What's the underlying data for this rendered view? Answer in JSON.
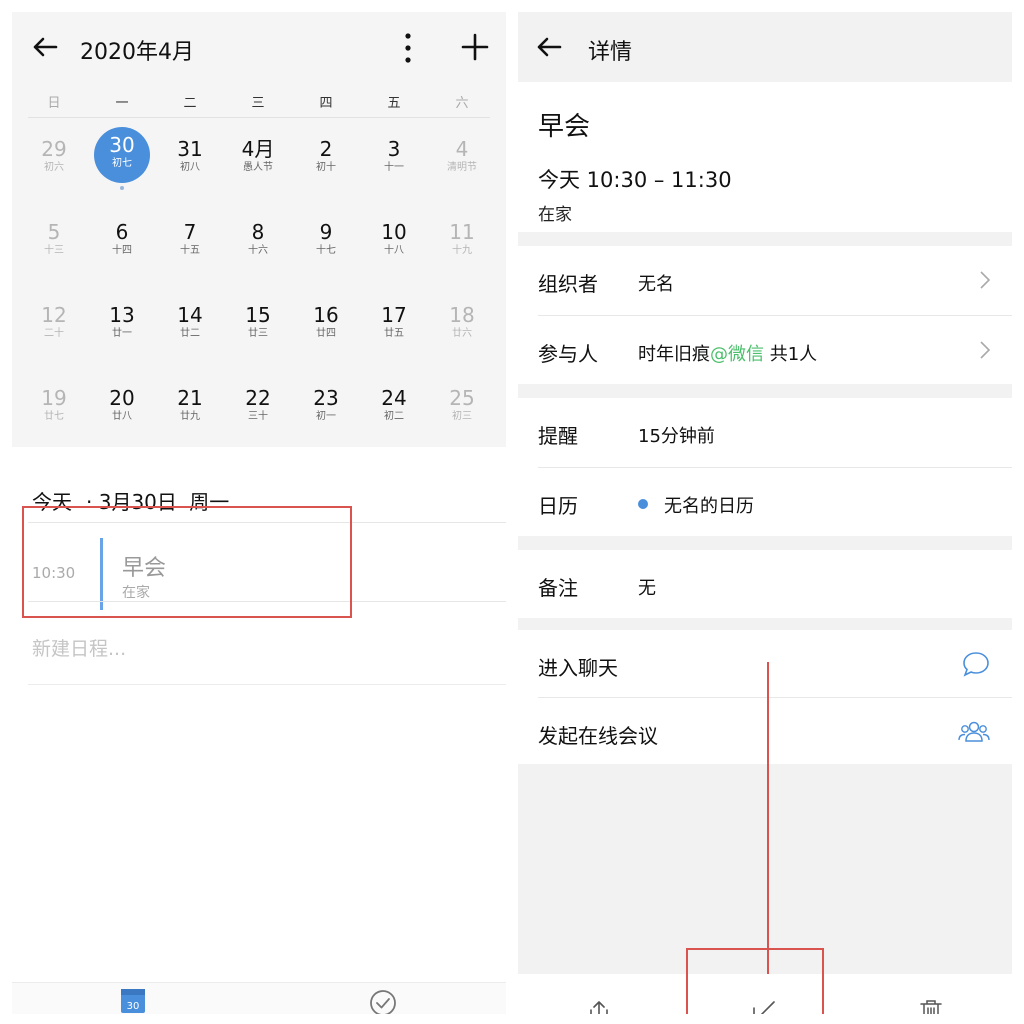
{
  "left": {
    "header": {
      "month_title": "2020年4月"
    },
    "weekdays": [
      "日",
      "一",
      "二",
      "三",
      "四",
      "五",
      "六"
    ],
    "weeks": [
      [
        {
          "num": "29",
          "lunar": "初六",
          "dim": true
        },
        {
          "num": "30",
          "lunar": "初七",
          "today": true
        },
        {
          "num": "31",
          "lunar": "初八"
        },
        {
          "num": "4月",
          "lunar": "愚人节"
        },
        {
          "num": "2",
          "lunar": "初十"
        },
        {
          "num": "3",
          "lunar": "十一"
        },
        {
          "num": "4",
          "lunar": "清明节",
          "dim": true
        }
      ],
      [
        {
          "num": "5",
          "lunar": "十三",
          "dim": true
        },
        {
          "num": "6",
          "lunar": "十四"
        },
        {
          "num": "7",
          "lunar": "十五"
        },
        {
          "num": "8",
          "lunar": "十六"
        },
        {
          "num": "9",
          "lunar": "十七"
        },
        {
          "num": "10",
          "lunar": "十八"
        },
        {
          "num": "11",
          "lunar": "十九",
          "dim": true
        }
      ],
      [
        {
          "num": "12",
          "lunar": "二十",
          "dim": true
        },
        {
          "num": "13",
          "lunar": "廿一"
        },
        {
          "num": "14",
          "lunar": "廿二"
        },
        {
          "num": "15",
          "lunar": "廿三"
        },
        {
          "num": "16",
          "lunar": "廿四"
        },
        {
          "num": "17",
          "lunar": "廿五"
        },
        {
          "num": "18",
          "lunar": "廿六",
          "dim": true
        }
      ],
      [
        {
          "num": "19",
          "lunar": "廿七",
          "dim": true
        },
        {
          "num": "20",
          "lunar": "廿八"
        },
        {
          "num": "21",
          "lunar": "廿九"
        },
        {
          "num": "22",
          "lunar": "三十"
        },
        {
          "num": "23",
          "lunar": "初一"
        },
        {
          "num": "24",
          "lunar": "初二"
        },
        {
          "num": "25",
          "lunar": "初三",
          "dim": true
        }
      ]
    ],
    "today_label": "今天",
    "today_date": "· 3月30日",
    "today_weekday": "周一",
    "event": {
      "time": "10:30",
      "title": "早会",
      "location": "在家"
    },
    "new_event_placeholder": "新建日程...",
    "tabbar": {
      "calendar_day": "30"
    }
  },
  "right": {
    "header": {
      "title": "详情"
    },
    "event_title": "早会",
    "event_time": "今天 10:30 – 11:30",
    "event_location": "在家",
    "organizer": {
      "label": "组织者",
      "value": "无名"
    },
    "participants": {
      "label": "参与人",
      "name": "时年旧痕",
      "source": "@微信",
      "count": "共1人"
    },
    "reminder": {
      "label": "提醒",
      "value": "15分钟前"
    },
    "calendar": {
      "label": "日历",
      "value": "无名的日历"
    },
    "note": {
      "label": "备注",
      "value": "无"
    },
    "chat": {
      "label": "进入聊天"
    },
    "meeting": {
      "label": "发起在线会议"
    }
  },
  "colors": {
    "accent_blue": "#4a8fdc",
    "annotation_red": "#d9534f",
    "wechat_green": "#4bbf6b"
  },
  "icons": {
    "back": "arrow-left-icon",
    "more": "more-vertical-icon",
    "add": "plus-icon",
    "chevron": "chevron-right-icon",
    "chat": "chat-bubble-icon",
    "meeting": "group-users-icon",
    "share": "share-icon",
    "edit": "edit-icon",
    "delete": "trash-icon",
    "tab_calendar": "calendar-icon",
    "tab_done": "check-circle-icon"
  }
}
